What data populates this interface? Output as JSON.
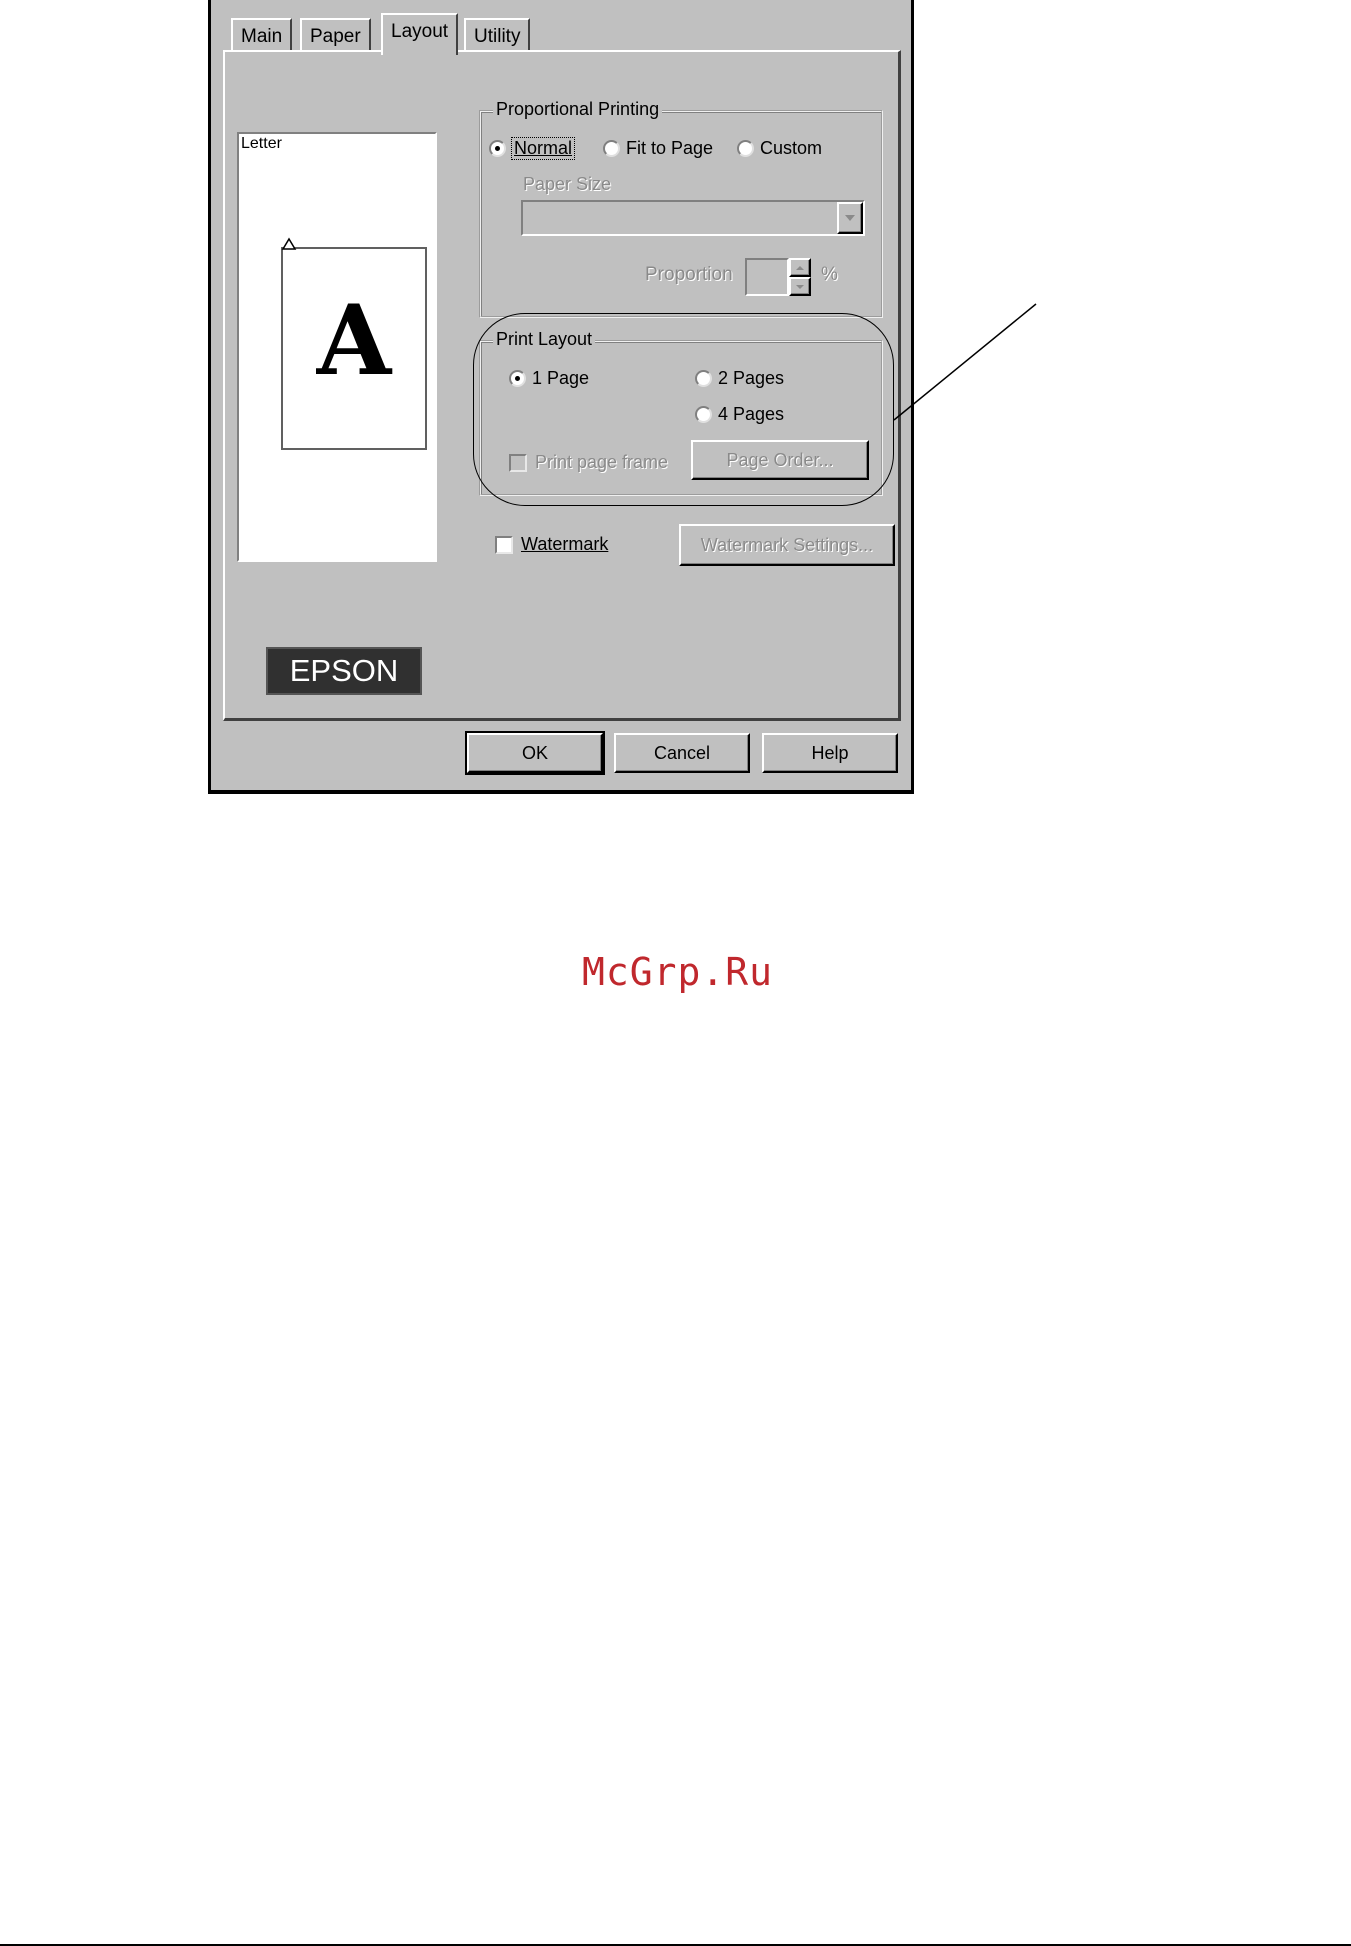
{
  "tabs": [
    {
      "label": "Main",
      "active": false
    },
    {
      "label": "Paper",
      "active": false
    },
    {
      "label": "Layout",
      "active": true
    },
    {
      "label": "Utility",
      "active": false
    }
  ],
  "preview": {
    "paper_label": "Letter",
    "sample_letter": "A"
  },
  "proportional_printing": {
    "title": "Proportional Printing",
    "options": [
      {
        "label": "Normal",
        "selected": true
      },
      {
        "label": "Fit to Page",
        "selected": false
      },
      {
        "label": "Custom",
        "selected": false
      }
    ],
    "paper_size_label": "Paper Size",
    "paper_size_value": "",
    "proportion_label": "Proportion",
    "proportion_value": "",
    "proportion_unit": "%"
  },
  "print_layout": {
    "title": "Print Layout",
    "options": [
      {
        "label": "1 Page",
        "selected": true
      },
      {
        "label": "2 Pages",
        "selected": false
      },
      {
        "label": "4 Pages",
        "selected": false
      }
    ],
    "print_page_frame_label": "Print page frame",
    "page_order_button": "Page Order..."
  },
  "watermark": {
    "label": "Watermark",
    "checked": false,
    "settings_button": "Watermark Settings..."
  },
  "logo": "EPSON",
  "buttons": {
    "ok": "OK",
    "cancel": "Cancel",
    "help": "Help"
  },
  "site_watermark": "McGrp.Ru",
  "colors": {
    "dialog": "#c0c0c0",
    "watermark_text": "#c0282d"
  }
}
